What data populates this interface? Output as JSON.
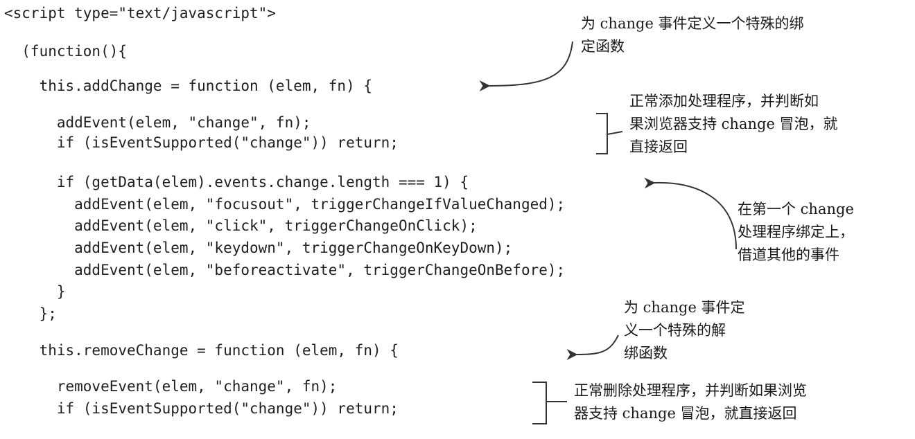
{
  "code_lines": [
    "<script type=\"text/javascript\">",
    "  (function(){",
    "    this.addChange = function (elem, fn) {",
    "      addEvent(elem, \"change\", fn);",
    "      if (isEventSupported(\"change\")) return;",
    "      if (getData(elem).events.change.length === 1) {",
    "        addEvent(elem, \"focusout\", triggerChangeIfValueChanged);",
    "        addEvent(elem, \"click\", triggerChangeOnClick);",
    "        addEvent(elem, \"keydown\", triggerChangeOnKeyDown);",
    "        addEvent(elem, \"beforeactivate\", triggerChangeOnBefore);",
    "      }",
    "    };",
    "    this.removeChange = function (elem, fn) {",
    "      removeEvent(elem, \"change\", fn);",
    "      if (isEventSupported(\"change\")) return;"
  ],
  "annotations": [
    {
      "lines": [
        "为 change 事件定义一个特殊的绑",
        "定函数"
      ]
    },
    {
      "lines": [
        "正常添加处理程序，并判断如",
        "果浏览器支持 change 冒泡，就",
        "直接返回"
      ]
    },
    {
      "lines": [
        "在第一个 change",
        "处理程序绑定上，",
        "借道其他的事件"
      ]
    },
    {
      "lines": [
        "为 change 事件定",
        "义一个特殊的解",
        "绑函数"
      ]
    },
    {
      "lines": [
        "正常删除处理程序，并判断如果浏览",
        "器支持 change 冒泡，就直接返回"
      ]
    }
  ]
}
